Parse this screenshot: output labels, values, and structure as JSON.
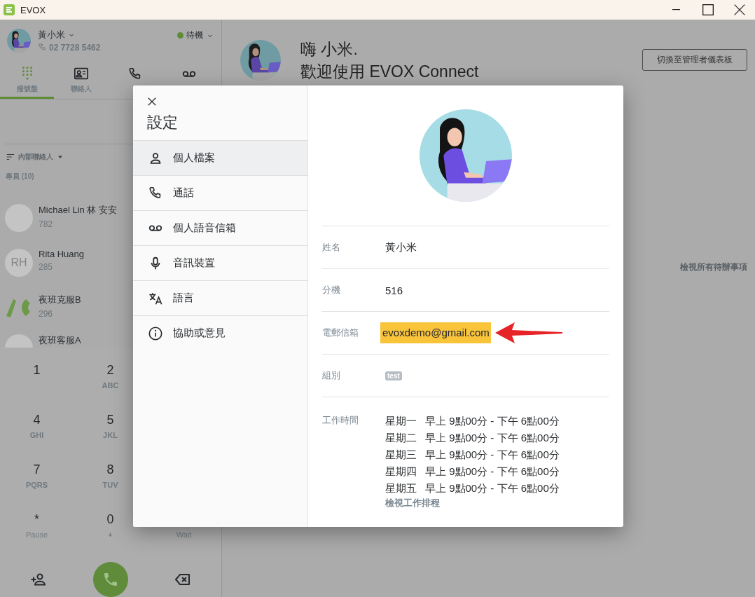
{
  "window": {
    "title": "EVOX"
  },
  "user": {
    "name": "黃小米",
    "phone": "02 7728 5462",
    "status": "待機"
  },
  "nav_tabs": [
    {
      "label": "撥號盤",
      "selected": true
    },
    {
      "label": "聯絡人",
      "selected": false
    },
    {
      "selected": false
    },
    {
      "selected": false
    }
  ],
  "contact_filter": "內部聯絡人",
  "contact_group": "專員 (10)",
  "contacts": [
    {
      "kind": "blank",
      "name": "Michael Lin 林 安安",
      "extension": "782"
    },
    {
      "kind": "initials",
      "initials": "RH",
      "name": "Rita Huang",
      "extension": "285"
    },
    {
      "kind": "image",
      "name": "夜班克服B",
      "extension": "296"
    },
    {
      "kind": "blank",
      "name": "夜班客服A"
    }
  ],
  "keypad": [
    {
      "keys": [
        {
          "digit": "1"
        },
        {
          "digit": "2",
          "letters": "ABC"
        }
      ]
    },
    {
      "keys": [
        {
          "digit": "4",
          "letters": "GHI"
        },
        {
          "digit": "5",
          "letters": "JKL"
        }
      ]
    },
    {
      "keys": [
        {
          "digit": "7",
          "letters": "PQRS"
        },
        {
          "digit": "8",
          "letters": "TUV"
        }
      ]
    },
    {
      "keys": [
        {
          "digit": "*",
          "letters": "Pause"
        },
        {
          "digit": "0",
          "letters": "+"
        },
        {
          "letters": "Wait"
        }
      ]
    }
  ],
  "main": {
    "greeting": "嗨 小米.",
    "welcome": "歡迎使用 EVOX Connect",
    "switch_button": "切換至管理者儀表板",
    "todo_link": "檢視所有待辦事項"
  },
  "settings": {
    "title": "設定",
    "menu": [
      {
        "label": "個人檔案",
        "selected": true
      },
      {
        "label": "通話",
        "selected": false
      },
      {
        "label": "個人語音信箱",
        "selected": false
      },
      {
        "label": "音訊裝置",
        "selected": false
      },
      {
        "label": "語言",
        "selected": false
      },
      {
        "label": "協助或意見",
        "selected": false
      }
    ],
    "profile": [
      {
        "kind": "text",
        "label": "姓名",
        "value": "黃小米",
        "annotated": false
      },
      {
        "kind": "text",
        "label": "分機",
        "value": "516",
        "annotated": false
      },
      {
        "kind": "text",
        "label": "電郵信箱",
        "value": "evoxdemo@gmail.com",
        "annotated": true
      },
      {
        "kind": "tags",
        "label": "組別",
        "tags": [
          "test"
        ]
      },
      {
        "kind": "schedule",
        "label": "工作時間",
        "schedule": [
          {
            "day": "星期一",
            "hours": "早上 9點00分 - 下午 6點00分"
          },
          {
            "day": "星期二",
            "hours": "早上 9點00分 - 下午 6點00分"
          },
          {
            "day": "星期三",
            "hours": "早上 9點00分 - 下午 6點00分"
          },
          {
            "day": "星期四",
            "hours": "早上 9點00分 - 下午 6點00分"
          },
          {
            "day": "星期五",
            "hours": "早上 9點00分 - 下午 6點00分"
          }
        ],
        "link": "檢視工作排程"
      }
    ]
  }
}
